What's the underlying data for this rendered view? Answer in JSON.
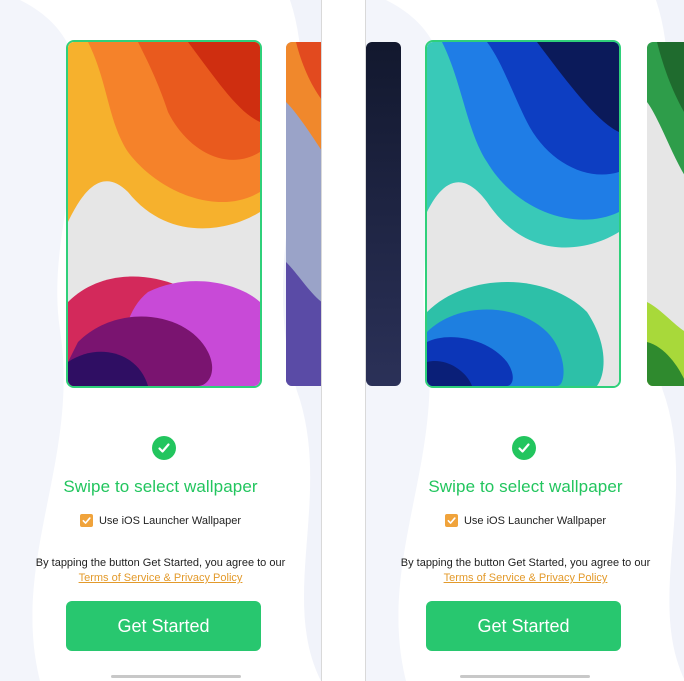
{
  "screens": [
    {
      "selected_wallpaper": "orange",
      "title": "Swipe to select wallpaper",
      "option_label": "Use iOS Launcher Wallpaper",
      "option_checked": true,
      "agree_text": "By tapping the button Get Started, you agree to our",
      "terms_link": "Terms of Service & Privacy Policy",
      "button_label": "Get Started"
    },
    {
      "selected_wallpaper": "blue",
      "title": "Swipe to select wallpaper",
      "option_label": "Use iOS Launcher Wallpaper",
      "option_checked": true,
      "agree_text": "By tapping the button Get Started, you agree to our",
      "terms_link": "Terms of Service & Privacy Policy",
      "button_label": "Get Started"
    }
  ],
  "colors": {
    "accent_green": "#22c55e",
    "button_green": "#28c76f",
    "checkbox_orange": "#f0a33b",
    "link_orange": "#e39a2b"
  },
  "icons": [
    "check-circle-icon",
    "checkbox-checked-icon"
  ]
}
